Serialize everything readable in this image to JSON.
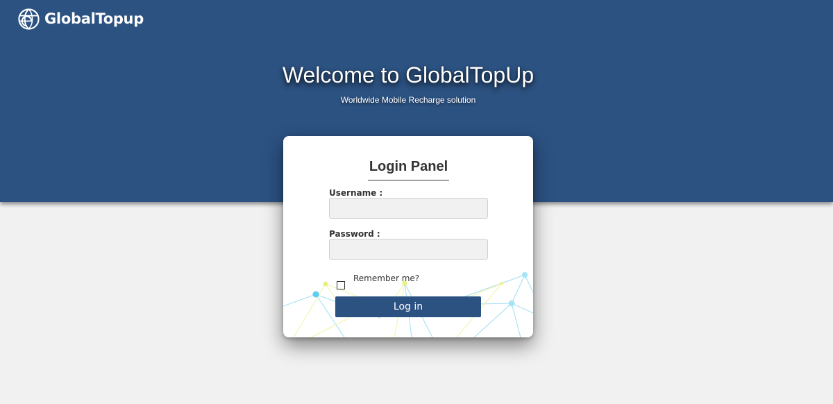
{
  "brand": {
    "logo_text": "GlobalTopup",
    "logo_icon": "globe-icon",
    "primary_color": "#2c5282",
    "background_color": "#f1f1f1"
  },
  "hero": {
    "title": "Welcome to GlobalTopUp",
    "subtitle": "Worldwide Mobile Recharge solution"
  },
  "login": {
    "title": "Login Panel",
    "username_label": "Username :",
    "username_value": "",
    "password_label": "Password :",
    "password_value": "",
    "remember_label": "Remember me?",
    "remember_checked": false,
    "submit_label": "Log in"
  }
}
